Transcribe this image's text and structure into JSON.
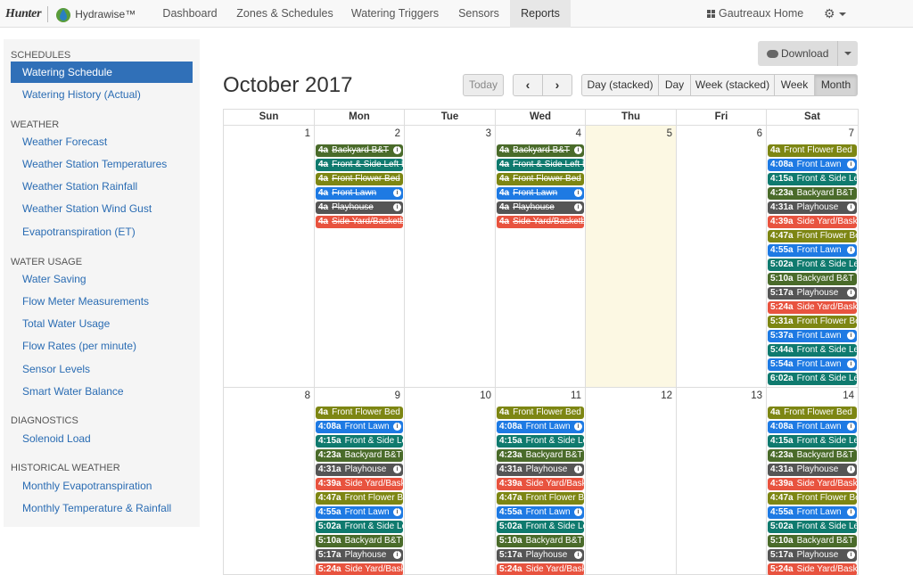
{
  "brand": {
    "hunter": "Hunter",
    "hydrawise": "Hydrawise™"
  },
  "nav": {
    "items": [
      "Dashboard",
      "Zones & Schedules",
      "Watering Triggers",
      "Sensors",
      "Reports"
    ],
    "active": "Reports",
    "account": "Gautreaux Home"
  },
  "sidebar": {
    "sections": [
      {
        "title": "SCHEDULES",
        "items": [
          "Watering Schedule",
          "Watering History (Actual)"
        ]
      },
      {
        "title": "WEATHER",
        "items": [
          "Weather Forecast",
          "Weather Station Temperatures",
          "Weather Station Rainfall",
          "Weather Station Wind Gust",
          "Evapotranspiration (ET)"
        ]
      },
      {
        "title": "WATER USAGE",
        "items": [
          "Water Saving",
          "Flow Meter Measurements",
          "Total Water Usage",
          "Flow Rates (per minute)",
          "Sensor Levels",
          "Smart Water Balance"
        ]
      },
      {
        "title": "DIAGNOSTICS",
        "items": [
          "Solenoid Load"
        ]
      },
      {
        "title": "HISTORICAL WEATHER",
        "items": [
          "Monthly Evapotranspiration",
          "Monthly Temperature & Rainfall"
        ]
      }
    ],
    "active": "Watering Schedule"
  },
  "toolbar": {
    "download": "Download",
    "today": "Today",
    "prev": "‹",
    "next": "›",
    "views": [
      "Day (stacked)",
      "Day",
      "Week (stacked)",
      "Week",
      "Month"
    ],
    "active_view": "Month"
  },
  "colors": {
    "backyard": "#4a6b2a",
    "front_side": "#0f7a6e",
    "front_flower": "#7d8613",
    "front_lawn": "#1e7ae3",
    "playhouse": "#555555",
    "side_yard": "#e8533f"
  },
  "calendar": {
    "title": "October 2017",
    "weekdays": [
      "Sun",
      "Mon",
      "Tue",
      "Wed",
      "Thu",
      "Fri",
      "Sat"
    ],
    "today": "5",
    "weeks": [
      {
        "days": [
          {
            "num": "1",
            "events": []
          },
          {
            "num": "2",
            "events": [
              {
                "time": "4a",
                "name": "Backyard B&T",
                "zone": "backyard",
                "past": true,
                "info": true
              },
              {
                "time": "4a",
                "name": "Front & Side Left Lawn",
                "zone": "front_side",
                "past": true,
                "info": false
              },
              {
                "time": "4a",
                "name": "Front Flower Bed",
                "zone": "front_flower",
                "past": true,
                "info": false
              },
              {
                "time": "4a",
                "name": "Front Lawn",
                "zone": "front_lawn",
                "past": true,
                "info": true
              },
              {
                "time": "4a",
                "name": "Playhouse",
                "zone": "playhouse",
                "past": true,
                "info": true
              },
              {
                "time": "4a",
                "name": "Side Yard/Basketball",
                "zone": "side_yard",
                "past": true,
                "info": false
              }
            ]
          },
          {
            "num": "3",
            "events": []
          },
          {
            "num": "4",
            "events": [
              {
                "time": "4a",
                "name": "Backyard B&T",
                "zone": "backyard",
                "past": true,
                "info": true
              },
              {
                "time": "4a",
                "name": "Front & Side Left Lawn",
                "zone": "front_side",
                "past": true,
                "info": false
              },
              {
                "time": "4a",
                "name": "Front Flower Bed",
                "zone": "front_flower",
                "past": true,
                "info": false
              },
              {
                "time": "4a",
                "name": "Front Lawn",
                "zone": "front_lawn",
                "past": true,
                "info": true
              },
              {
                "time": "4a",
                "name": "Playhouse",
                "zone": "playhouse",
                "past": true,
                "info": true
              },
              {
                "time": "4a",
                "name": "Side Yard/Basketball",
                "zone": "side_yard",
                "past": true,
                "info": false
              }
            ]
          },
          {
            "num": "5",
            "events": []
          },
          {
            "num": "6",
            "events": []
          },
          {
            "num": "7",
            "events": [
              {
                "time": "4a",
                "name": "Front Flower Bed",
                "zone": "front_flower",
                "past": false,
                "info": false
              },
              {
                "time": "4:08a",
                "name": "Front Lawn",
                "zone": "front_lawn",
                "past": false,
                "info": true
              },
              {
                "time": "4:15a",
                "name": "Front & Side Left Lawn",
                "zone": "front_side",
                "past": false,
                "info": false
              },
              {
                "time": "4:23a",
                "name": "Backyard B&T",
                "zone": "backyard",
                "past": false,
                "info": false
              },
              {
                "time": "4:31a",
                "name": "Playhouse",
                "zone": "playhouse",
                "past": false,
                "info": true
              },
              {
                "time": "4:39a",
                "name": "Side Yard/Basketball",
                "zone": "side_yard",
                "past": false,
                "info": false
              },
              {
                "time": "4:47a",
                "name": "Front Flower Bed",
                "zone": "front_flower",
                "past": false,
                "info": false
              },
              {
                "time": "4:55a",
                "name": "Front Lawn",
                "zone": "front_lawn",
                "past": false,
                "info": true
              },
              {
                "time": "5:02a",
                "name": "Front & Side Left Lawn",
                "zone": "front_side",
                "past": false,
                "info": false
              },
              {
                "time": "5:10a",
                "name": "Backyard B&T",
                "zone": "backyard",
                "past": false,
                "info": false
              },
              {
                "time": "5:17a",
                "name": "Playhouse",
                "zone": "playhouse",
                "past": false,
                "info": true
              },
              {
                "time": "5:24a",
                "name": "Side Yard/Basketball",
                "zone": "side_yard",
                "past": false,
                "info": false
              },
              {
                "time": "5:31a",
                "name": "Front Flower Bed",
                "zone": "front_flower",
                "past": false,
                "info": false
              },
              {
                "time": "5:37a",
                "name": "Front Lawn",
                "zone": "front_lawn",
                "past": false,
                "info": true
              },
              {
                "time": "5:44a",
                "name": "Front & Side Left Lawn",
                "zone": "front_side",
                "past": false,
                "info": false
              },
              {
                "time": "5:54a",
                "name": "Front Lawn",
                "zone": "front_lawn",
                "past": false,
                "info": true
              },
              {
                "time": "6:02a",
                "name": "Front & Side Left Lawn",
                "zone": "front_side",
                "past": false,
                "info": false
              }
            ]
          }
        ]
      },
      {
        "days": [
          {
            "num": "8",
            "events": []
          },
          {
            "num": "9",
            "events": [
              {
                "time": "4a",
                "name": "Front Flower Bed",
                "zone": "front_flower",
                "past": false,
                "info": false
              },
              {
                "time": "4:08a",
                "name": "Front Lawn",
                "zone": "front_lawn",
                "past": false,
                "info": true
              },
              {
                "time": "4:15a",
                "name": "Front & Side Left Lawn",
                "zone": "front_side",
                "past": false,
                "info": false
              },
              {
                "time": "4:23a",
                "name": "Backyard B&T",
                "zone": "backyard",
                "past": false,
                "info": false
              },
              {
                "time": "4:31a",
                "name": "Playhouse",
                "zone": "playhouse",
                "past": false,
                "info": true
              },
              {
                "time": "4:39a",
                "name": "Side Yard/Basketball",
                "zone": "side_yard",
                "past": false,
                "info": false
              },
              {
                "time": "4:47a",
                "name": "Front Flower Bed",
                "zone": "front_flower",
                "past": false,
                "info": false
              },
              {
                "time": "4:55a",
                "name": "Front Lawn",
                "zone": "front_lawn",
                "past": false,
                "info": true
              },
              {
                "time": "5:02a",
                "name": "Front & Side Left Lawn",
                "zone": "front_side",
                "past": false,
                "info": false
              },
              {
                "time": "5:10a",
                "name": "Backyard B&T",
                "zone": "backyard",
                "past": false,
                "info": false
              },
              {
                "time": "5:17a",
                "name": "Playhouse",
                "zone": "playhouse",
                "past": false,
                "info": true
              },
              {
                "time": "5:24a",
                "name": "Side Yard/Basketball",
                "zone": "side_yard",
                "past": false,
                "info": false
              }
            ]
          },
          {
            "num": "10",
            "events": []
          },
          {
            "num": "11",
            "events": [
              {
                "time": "4a",
                "name": "Front Flower Bed",
                "zone": "front_flower",
                "past": false,
                "info": false
              },
              {
                "time": "4:08a",
                "name": "Front Lawn",
                "zone": "front_lawn",
                "past": false,
                "info": true
              },
              {
                "time": "4:15a",
                "name": "Front & Side Left Lawn",
                "zone": "front_side",
                "past": false,
                "info": false
              },
              {
                "time": "4:23a",
                "name": "Backyard B&T",
                "zone": "backyard",
                "past": false,
                "info": false
              },
              {
                "time": "4:31a",
                "name": "Playhouse",
                "zone": "playhouse",
                "past": false,
                "info": true
              },
              {
                "time": "4:39a",
                "name": "Side Yard/Basketball",
                "zone": "side_yard",
                "past": false,
                "info": false
              },
              {
                "time": "4:47a",
                "name": "Front Flower Bed",
                "zone": "front_flower",
                "past": false,
                "info": false
              },
              {
                "time": "4:55a",
                "name": "Front Lawn",
                "zone": "front_lawn",
                "past": false,
                "info": true
              },
              {
                "time": "5:02a",
                "name": "Front & Side Left Lawn",
                "zone": "front_side",
                "past": false,
                "info": false
              },
              {
                "time": "5:10a",
                "name": "Backyard B&T",
                "zone": "backyard",
                "past": false,
                "info": false
              },
              {
                "time": "5:17a",
                "name": "Playhouse",
                "zone": "playhouse",
                "past": false,
                "info": true
              },
              {
                "time": "5:24a",
                "name": "Side Yard/Basketball",
                "zone": "side_yard",
                "past": false,
                "info": false
              }
            ]
          },
          {
            "num": "12",
            "events": []
          },
          {
            "num": "13",
            "events": []
          },
          {
            "num": "14",
            "events": [
              {
                "time": "4a",
                "name": "Front Flower Bed",
                "zone": "front_flower",
                "past": false,
                "info": false
              },
              {
                "time": "4:08a",
                "name": "Front Lawn",
                "zone": "front_lawn",
                "past": false,
                "info": true
              },
              {
                "time": "4:15a",
                "name": "Front & Side Left Lawn",
                "zone": "front_side",
                "past": false,
                "info": false
              },
              {
                "time": "4:23a",
                "name": "Backyard B&T",
                "zone": "backyard",
                "past": false,
                "info": false
              },
              {
                "time": "4:31a",
                "name": "Playhouse",
                "zone": "playhouse",
                "past": false,
                "info": true
              },
              {
                "time": "4:39a",
                "name": "Side Yard/Basketball",
                "zone": "side_yard",
                "past": false,
                "info": false
              },
              {
                "time": "4:47a",
                "name": "Front Flower Bed",
                "zone": "front_flower",
                "past": false,
                "info": false
              },
              {
                "time": "4:55a",
                "name": "Front Lawn",
                "zone": "front_lawn",
                "past": false,
                "info": true
              },
              {
                "time": "5:02a",
                "name": "Front & Side Left Lawn",
                "zone": "front_side",
                "past": false,
                "info": false
              },
              {
                "time": "5:10a",
                "name": "Backyard B&T",
                "zone": "backyard",
                "past": false,
                "info": false
              },
              {
                "time": "5:17a",
                "name": "Playhouse",
                "zone": "playhouse",
                "past": false,
                "info": true
              },
              {
                "time": "5:24a",
                "name": "Side Yard/Basketball",
                "zone": "side_yard",
                "past": false,
                "info": false
              }
            ]
          }
        ]
      }
    ]
  }
}
